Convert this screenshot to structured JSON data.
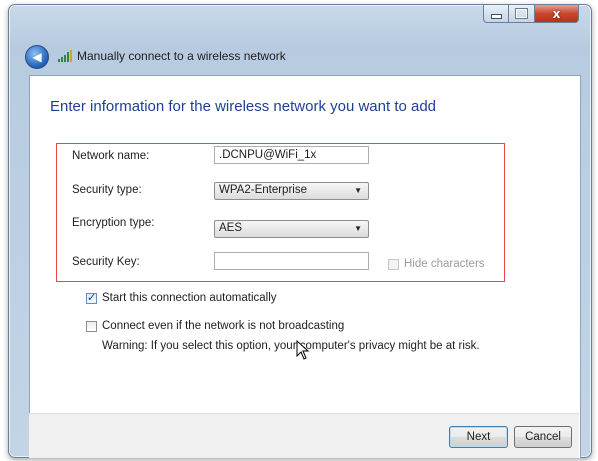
{
  "window": {
    "title": "Manually connect to a wireless network",
    "caption_buttons": {
      "minimize": "",
      "maximize": "",
      "close": "x"
    }
  },
  "nav": {
    "back_glyph": "◀"
  },
  "heading": "Enter information for the wireless network you want to add",
  "form": {
    "network_name": {
      "label": "Network name:",
      "value": ".DCNPU@WiFi_1x"
    },
    "security_type": {
      "label": "Security type:",
      "value": "WPA2-Enterprise"
    },
    "encryption_type": {
      "label": "Encryption type:",
      "value": "AES"
    },
    "security_key": {
      "label": "Security Key:",
      "value": ""
    },
    "hide_characters": {
      "label": "Hide characters",
      "checked": false,
      "enabled": false
    }
  },
  "options": {
    "start_automatically": {
      "label": "Start this connection automatically",
      "checked": true
    },
    "connect_not_broadcasting": {
      "label": "Connect even if the network is not broadcasting",
      "checked": false
    },
    "warning": "Warning: If you select this option, your computer's privacy might be at risk."
  },
  "buttons": {
    "next": "Next",
    "cancel": "Cancel"
  },
  "colors": {
    "heading": "#1e3f95",
    "highlight_box": "#e04a4a",
    "close_button": "#c9472c"
  },
  "icons": [
    "back-arrow-icon",
    "wireless-signal-icon",
    "dropdown-arrow-icon",
    "mouse-cursor-icon"
  ]
}
